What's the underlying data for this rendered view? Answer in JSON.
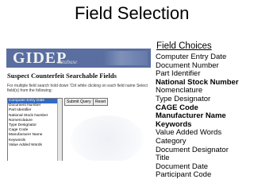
{
  "slide": {
    "title": "Field Selection"
  },
  "choices": {
    "heading": "Field Choices",
    "items": [
      {
        "label": "Computer Entry Date",
        "bold": false
      },
      {
        "label": "Document Number",
        "bold": false
      },
      {
        "label": "Part Identifier",
        "bold": false
      },
      {
        "label": "National Stock Number",
        "bold": true
      },
      {
        "label": "Nomenclature",
        "bold": false
      },
      {
        "label": "Type Designator",
        "bold": false
      },
      {
        "label": "CAGE Code",
        "bold": true
      },
      {
        "label": "Manufacturer Name",
        "bold": true
      },
      {
        "label": "Keywords",
        "bold": true
      },
      {
        "label": "Value Added Words",
        "bold": false
      },
      {
        "label": "Category",
        "bold": false
      },
      {
        "label": "Document Designator",
        "bold": false
      },
      {
        "label": "Title",
        "bold": false
      },
      {
        "label": "Document Date",
        "bold": false
      },
      {
        "label": "Participant Code",
        "bold": false
      }
    ]
  },
  "screenshot": {
    "logo": "GIDEP",
    "logo_sub": "database",
    "heading": "Suspect Counterfeit Searchable Fields",
    "help": "For multiple field search hold down 'Ctrl while clicking on each field name Select field(s) from the following:",
    "fields": [
      {
        "label": "Computer Entry Date",
        "selected": true
      },
      {
        "label": "Document Number",
        "selected": false
      },
      {
        "label": "Part Identifier",
        "selected": false
      },
      {
        "label": "National Stock Number",
        "selected": false
      },
      {
        "label": "Nomenclature",
        "selected": false
      },
      {
        "label": "Type Designator",
        "selected": false
      },
      {
        "label": "Cage Code",
        "selected": false
      },
      {
        "label": "Manufacturer Name",
        "selected": false
      },
      {
        "label": "Keywords",
        "selected": false
      },
      {
        "label": "Value Added Words",
        "selected": false
      }
    ],
    "submit_label": "Submit Query",
    "reset_label": "Reset"
  }
}
